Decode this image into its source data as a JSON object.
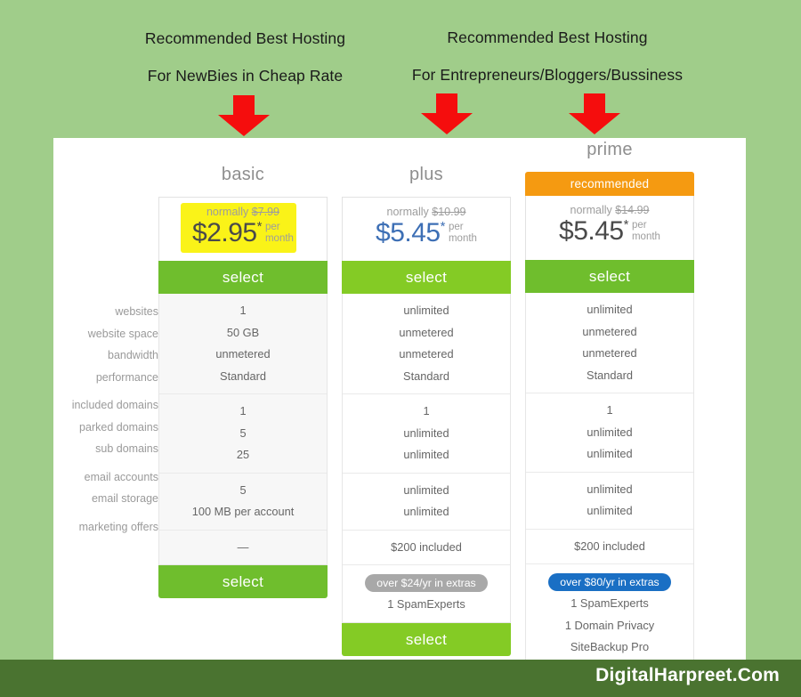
{
  "banner": {
    "groups": [
      {
        "line1": "Recommended  Best Hosting",
        "line2": "For NewBies in Cheap Rate"
      },
      {
        "line1": "Recommended  Best Hosting",
        "line2": "For Entrepreneurs/Bloggers/Bussiness"
      }
    ],
    "arrow_count": 3
  },
  "features": {
    "group1": [
      "websites",
      "website space",
      "bandwidth",
      "performance"
    ],
    "group2": [
      "included domains",
      "parked domains",
      "sub domains"
    ],
    "group3": [
      "email accounts",
      "email storage"
    ],
    "group4": [
      "marketing offers"
    ]
  },
  "plans": [
    {
      "name": "basic",
      "badge": null,
      "normally_label": "normally",
      "normally_price": "$7.99",
      "price": "$2.95",
      "star": "*",
      "per": "per",
      "month": "month",
      "select_label": "select",
      "bottom_select_label": "select",
      "highlighted": true,
      "price_color": "#4a4a4a",
      "group1": [
        "1",
        "50 GB",
        "unmetered",
        "Standard"
      ],
      "group2": [
        "1",
        "5",
        "25"
      ],
      "group3": [
        "5",
        "100 MB per account"
      ],
      "group4": [
        "—"
      ],
      "pill": null,
      "extras": []
    },
    {
      "name": "plus",
      "badge": null,
      "normally_label": "normally",
      "normally_price": "$10.99",
      "price": "$5.45",
      "star": "*",
      "per": "per",
      "month": "month",
      "select_label": "select",
      "bottom_select_label": "select",
      "highlighted": false,
      "price_color": "#3d6fb5",
      "group1": [
        "unlimited",
        "unmetered",
        "unmetered",
        "Standard"
      ],
      "group2": [
        "1",
        "unlimited",
        "unlimited"
      ],
      "group3": [
        "unlimited",
        "unlimited"
      ],
      "group4": [
        "$200 included"
      ],
      "pill": {
        "label": "over $24/yr in extras",
        "color": "#a8a8a8",
        "style": "grey"
      },
      "extras": [
        "1 SpamExperts"
      ]
    },
    {
      "name": "prime",
      "badge": "recommended",
      "normally_label": "normally",
      "normally_price": "$14.99",
      "price": "$5.45",
      "star": "*",
      "per": "per",
      "month": "month",
      "select_label": "select",
      "bottom_select_label": null,
      "highlighted": false,
      "price_color": "#4a4a4a",
      "group1": [
        "unlimited",
        "unmetered",
        "unmetered",
        "Standard"
      ],
      "group2": [
        "1",
        "unlimited",
        "unlimited"
      ],
      "group3": [
        "unlimited",
        "unlimited"
      ],
      "group4": [
        "$200 included"
      ],
      "pill": {
        "label": "over $80/yr in extras",
        "color": "#1a6fc4",
        "style": "blue"
      },
      "extras": [
        "1 SpamExperts",
        "1 Domain Privacy",
        "SiteBackup Pro"
      ]
    }
  ],
  "footer": {
    "watermark": "DigitalHarpreet.Com"
  },
  "colors": {
    "background": "#a0cd8a",
    "footer_bar": "#4a7330",
    "arrow_red": "#f50d0d",
    "select_green": "#6fbe2d",
    "select_lime": "#84cb25",
    "recommended_orange": "#f59a11",
    "highlight_yellow": "#faf318",
    "price_blue": "#3d6fb5",
    "pill_grey": "#a8a8a8",
    "pill_blue": "#1a6fc4"
  }
}
